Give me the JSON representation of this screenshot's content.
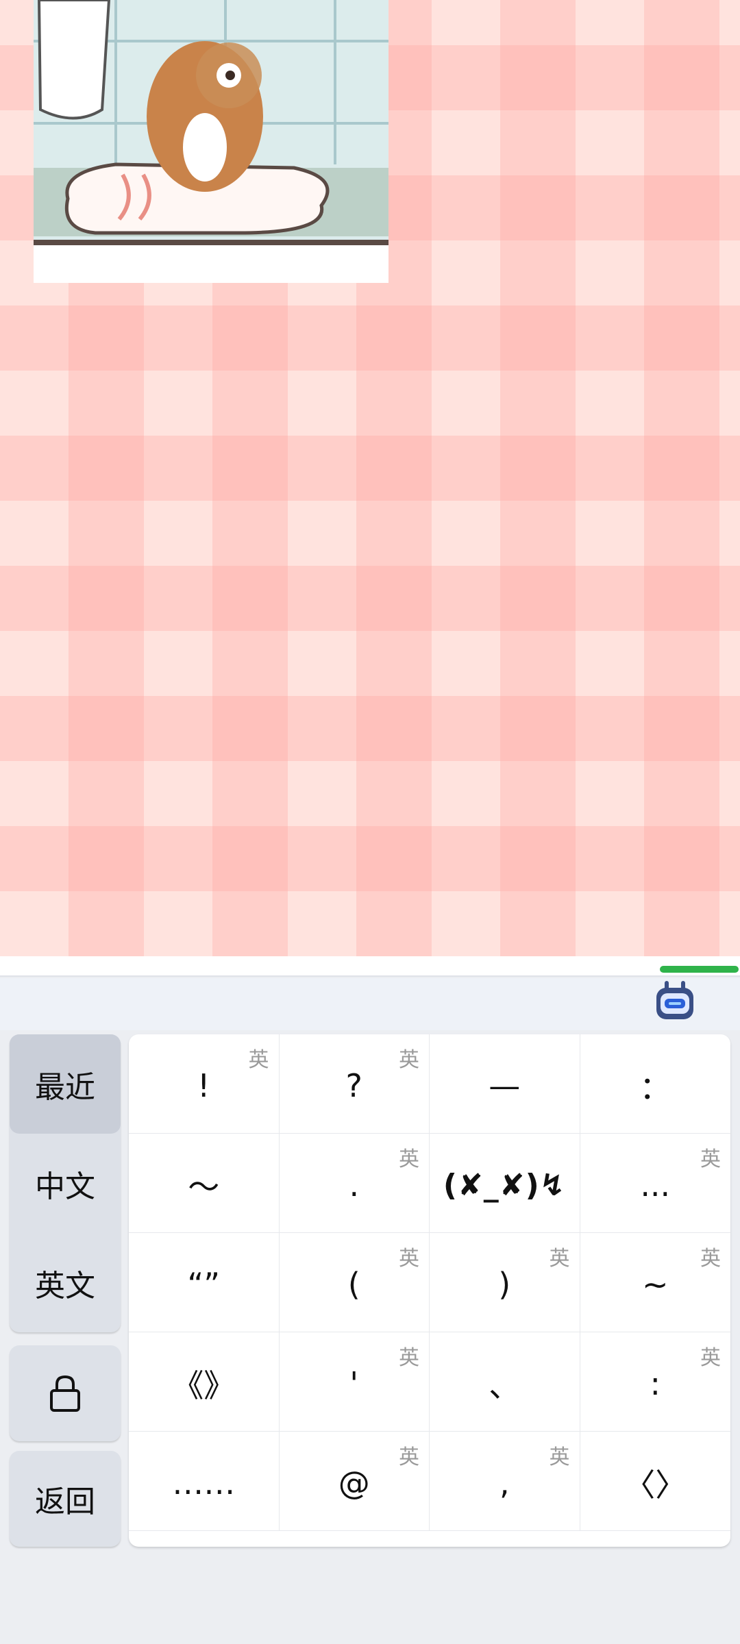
{
  "chat": {
    "sticker_icon": "cat-towel-sticker"
  },
  "toolbar": {
    "assistant_icon": "robot-assistant-icon",
    "accent_color": "#2fb34a"
  },
  "sidebar": {
    "tabs": [
      {
        "label": "最近",
        "active": true
      },
      {
        "label": "中文",
        "active": false
      },
      {
        "label": "英文",
        "active": false
      }
    ],
    "lock_icon": "lock-icon",
    "back_label": "返回"
  },
  "symbols": {
    "tag_label": "英",
    "keys": [
      {
        "symbol": "!",
        "tagged": true
      },
      {
        "symbol": "?",
        "tagged": true
      },
      {
        "symbol": "—",
        "tagged": false
      },
      {
        "symbol": "：",
        "tagged": false
      },
      {
        "symbol": "～",
        "tagged": false
      },
      {
        "symbol": ".",
        "tagged": true
      },
      {
        "symbol": "(✘_✘)↯",
        "tagged": false
      },
      {
        "symbol": "...",
        "tagged": true
      },
      {
        "symbol": "“”",
        "tagged": false
      },
      {
        "symbol": "(",
        "tagged": true
      },
      {
        "symbol": ")",
        "tagged": true
      },
      {
        "symbol": "~",
        "tagged": true
      },
      {
        "symbol": "《》",
        "tagged": false
      },
      {
        "symbol": "'",
        "tagged": true
      },
      {
        "symbol": "、",
        "tagged": false
      },
      {
        "symbol": ":",
        "tagged": true
      },
      {
        "symbol": "……",
        "tagged": false
      },
      {
        "symbol": "@",
        "tagged": true
      },
      {
        "symbol": ",",
        "tagged": true
      },
      {
        "symbol": "〈〉",
        "tagged": false
      }
    ]
  }
}
